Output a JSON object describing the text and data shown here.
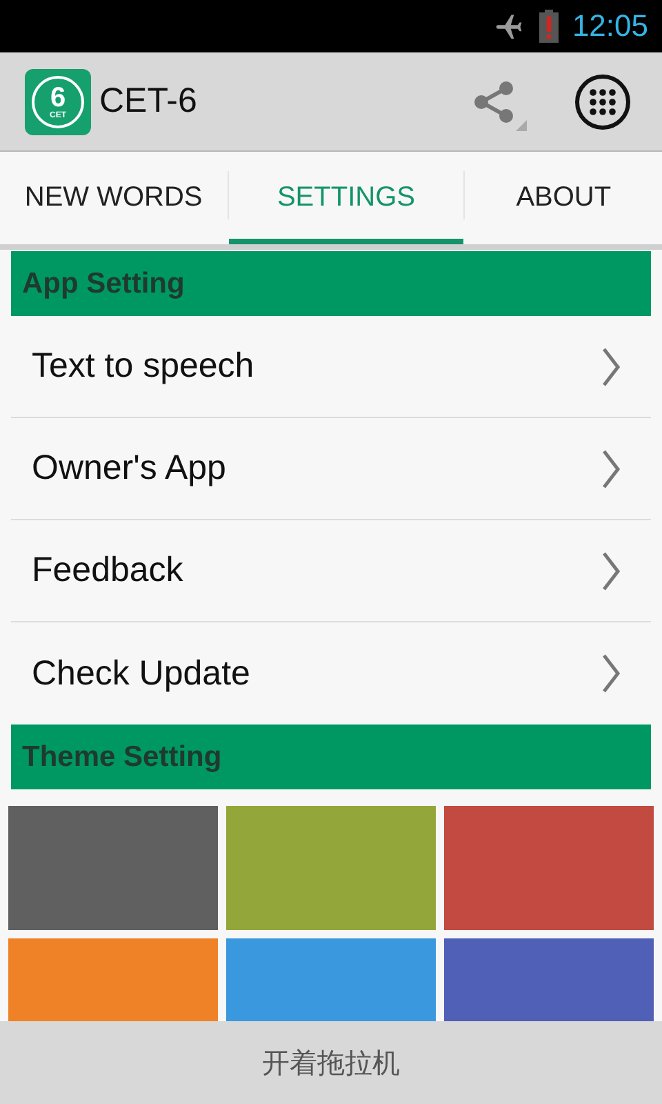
{
  "status_bar": {
    "time": "12:05",
    "airplane_mode": true,
    "battery_low": true
  },
  "app_bar": {
    "title": "CET-6",
    "logo": {
      "digit": "6",
      "caption": "CET"
    }
  },
  "tabs": [
    {
      "label": "NEW WORDS",
      "selected": false
    },
    {
      "label": "SETTINGS",
      "selected": true
    },
    {
      "label": "ABOUT",
      "selected": false
    }
  ],
  "sections": [
    {
      "title": "App Setting",
      "kind": "list",
      "items": [
        {
          "label": "Text to speech"
        },
        {
          "label": "Owner's App"
        },
        {
          "label": "Feedback"
        },
        {
          "label": "Check Update"
        }
      ]
    },
    {
      "title": "Theme Setting",
      "kind": "swatches",
      "swatches": [
        {
          "color": "#606060"
        },
        {
          "color": "#93a639"
        },
        {
          "color": "#c24a40"
        },
        {
          "color": "#ef8226"
        },
        {
          "color": "#3a98de"
        },
        {
          "color": "#5060b6"
        }
      ]
    }
  ],
  "bottom_bar": {
    "text": "开着拖拉机"
  }
}
